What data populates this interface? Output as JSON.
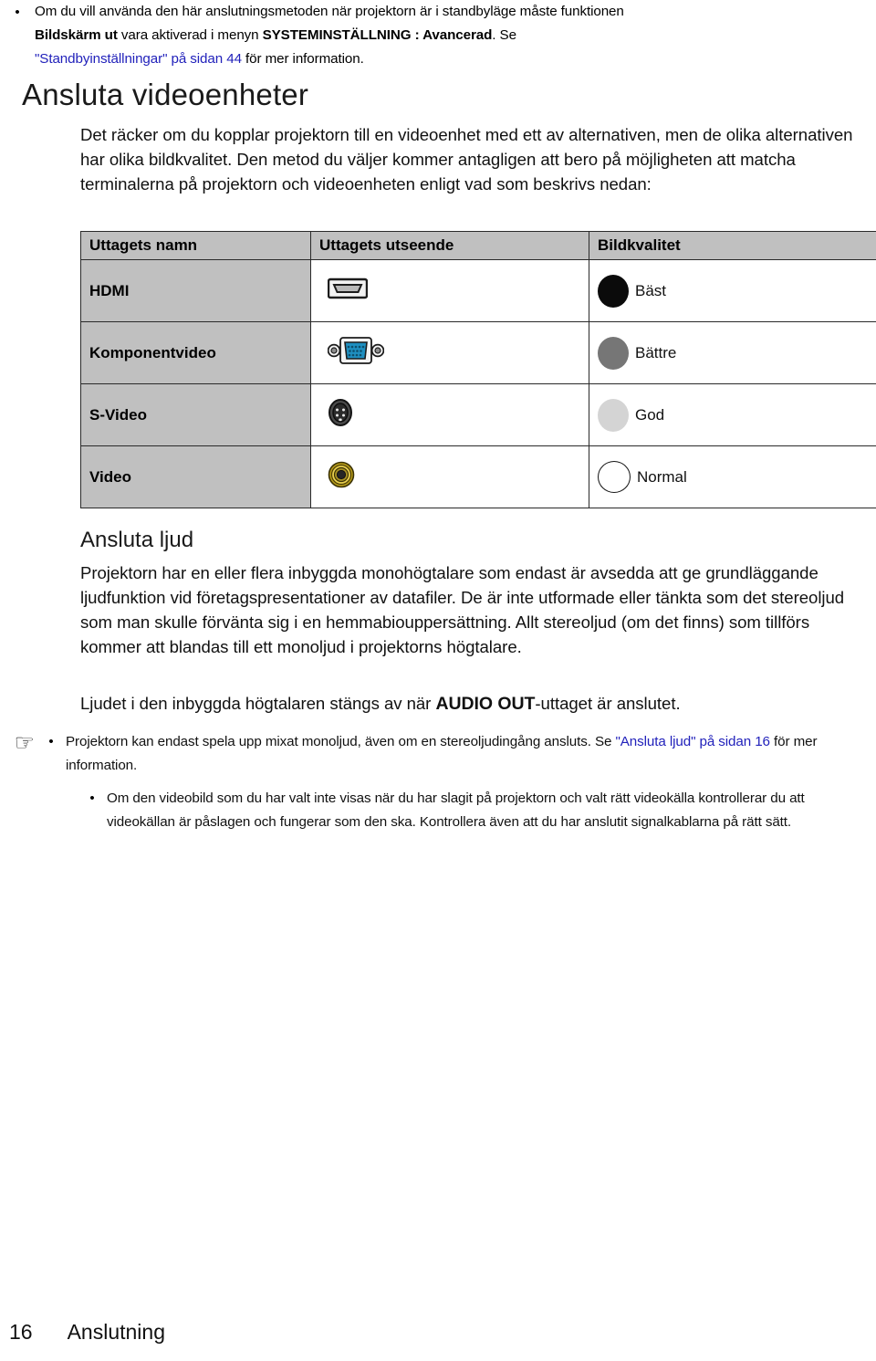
{
  "top_note": {
    "bullet": "•",
    "line1_a": "Om du vill använda den här anslutningsmetoden när projektorn är i standbyläge måste funktionen",
    "line2_bold_1": "Bildskärm ut",
    "line2_mid": " vara aktiverad i menyn ",
    "line2_bold_2": "SYSTEMINSTÄLLNING : Avancerad",
    "line2_end": ". Se",
    "line3_link": "\"Standbyinställningar\" på sidan 44",
    "line3_rest": " för mer information."
  },
  "section": {
    "title": "Ansluta videoenheter",
    "intro": "Det räcker om du kopplar projektorn till en videoenhet med ett av alternativen, men de olika alternativen har olika bildkvalitet. Den metod du väljer kommer antagligen att bero på möjligheten att matcha terminalerna på projektorn och videoenheten enligt vad som beskrivs nedan:"
  },
  "table": {
    "headers": [
      "Uttagets namn",
      "Uttagets utseende",
      "Bildkvalitet"
    ],
    "rows": [
      {
        "name": "HDMI",
        "icon": "hdmi-connector-icon",
        "quality_label": "Bäst",
        "quality_color": "#0b0b0b"
      },
      {
        "name": "Komponentvideo",
        "icon": "vga-dsub-connector-icon",
        "quality_label": "Bättre",
        "quality_color": "#767676"
      },
      {
        "name": "S-Video",
        "icon": "svideo-din-connector-icon",
        "quality_label": "God",
        "quality_color": "#d4d4d4"
      },
      {
        "name": "Video",
        "icon": "rca-composite-connector-icon",
        "quality_label": "Normal",
        "quality_color": "#ffffff"
      }
    ]
  },
  "audio": {
    "title": "Ansluta ljud",
    "para1": "Projektorn har en eller flera inbyggda monohögtalare som endast är avsedda att ge grundläggande ljudfunktion vid företagspresentationer av datafiler. De är inte utformade eller tänkta som det stereoljud som man skulle förvänta sig i en hemmabiouppersättning. Allt stereoljud (om det finns) som tillförs kommer att blandas till ett monoljud i projektorns högtalare.",
    "para2_start": "Ljudet i den inbyggda högtalaren stängs av när ",
    "para2_bold": "AUDIO OUT",
    "para2_end": "-uttaget är anslutet."
  },
  "bottom_notes": {
    "hand_icon": "☞",
    "bullet": "•",
    "note1_start": "Projektorn kan endast spela upp mixat monoljud, även om en stereoljudingång ansluts. Se ",
    "note1_link": "\"Ansluta ljud\" på sidan 16",
    "note1_end": " för mer information.",
    "note2": "Om den videobild som du har valt inte visas när du har slagit på projektorn och valt rätt videokälla kontrollerar du att videokällan är påslagen och fungerar som den ska. Kontrollera även att du har anslutit signalkablarna på rätt sätt."
  },
  "footer": {
    "page_number": "16",
    "chapter": "Anslutning"
  },
  "colors": {
    "link": "#2222bb",
    "table_gray": "#c0c0c0",
    "vga_blue": "#1f8fc0",
    "rca_yellow": "#d8bb2a"
  }
}
